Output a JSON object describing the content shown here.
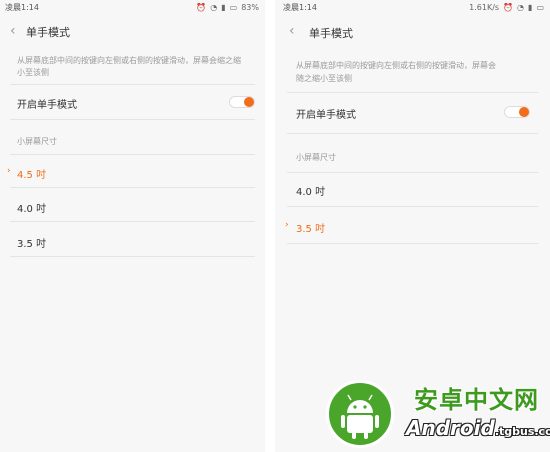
{
  "left": {
    "status": {
      "time": "凌晨1:14",
      "battery": "83%"
    },
    "title": "单手模式",
    "description": [
      "从屏幕底部中间的按键向左侧或右侧的按键滑动，屏幕会缩之缩",
      "小至该侧"
    ],
    "toggle_label": "开启单手模式",
    "toggle_on": true,
    "section_label": "小屏幕尺寸",
    "options": [
      {
        "label": "4.5 吋",
        "selected": true
      },
      {
        "label": "4.0 吋",
        "selected": false
      },
      {
        "label": "3.5 吋",
        "selected": false
      }
    ]
  },
  "right": {
    "status": {
      "time": "凌晨1:14",
      "speed": "1.61K/s"
    },
    "title": "单手模式",
    "description": [
      "从屏幕底部中间的按键向左侧或右侧的按键滑动，屏幕会",
      "随之缩小至该侧"
    ],
    "toggle_label": "开启单手模式",
    "toggle_on": true,
    "section_label": "小屏幕尺寸",
    "options": [
      {
        "label": "4.0 吋",
        "selected": false
      },
      {
        "label": "3.5 吋",
        "selected": true
      }
    ]
  },
  "watermark": {
    "cn": "安卓中文网",
    "en": "Android",
    "domain": ".tgbus.com"
  },
  "colors": {
    "accent": "#f06d1a",
    "background": "#f7f7f7"
  }
}
